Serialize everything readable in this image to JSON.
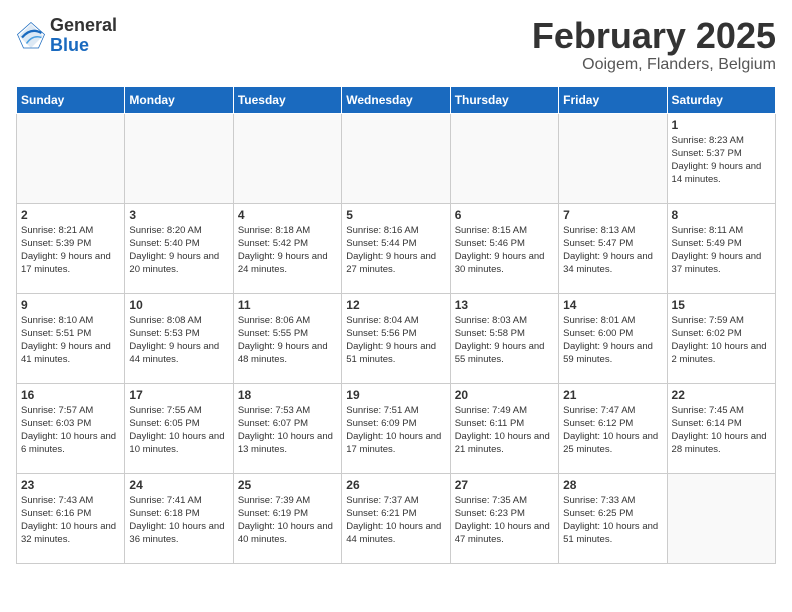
{
  "header": {
    "logo_general": "General",
    "logo_blue": "Blue",
    "month_title": "February 2025",
    "location": "Ooigem, Flanders, Belgium"
  },
  "days_of_week": [
    "Sunday",
    "Monday",
    "Tuesday",
    "Wednesday",
    "Thursday",
    "Friday",
    "Saturday"
  ],
  "weeks": [
    [
      {
        "day": "",
        "info": ""
      },
      {
        "day": "",
        "info": ""
      },
      {
        "day": "",
        "info": ""
      },
      {
        "day": "",
        "info": ""
      },
      {
        "day": "",
        "info": ""
      },
      {
        "day": "",
        "info": ""
      },
      {
        "day": "1",
        "info": "Sunrise: 8:23 AM\nSunset: 5:37 PM\nDaylight: 9 hours and 14 minutes."
      }
    ],
    [
      {
        "day": "2",
        "info": "Sunrise: 8:21 AM\nSunset: 5:39 PM\nDaylight: 9 hours and 17 minutes."
      },
      {
        "day": "3",
        "info": "Sunrise: 8:20 AM\nSunset: 5:40 PM\nDaylight: 9 hours and 20 minutes."
      },
      {
        "day": "4",
        "info": "Sunrise: 8:18 AM\nSunset: 5:42 PM\nDaylight: 9 hours and 24 minutes."
      },
      {
        "day": "5",
        "info": "Sunrise: 8:16 AM\nSunset: 5:44 PM\nDaylight: 9 hours and 27 minutes."
      },
      {
        "day": "6",
        "info": "Sunrise: 8:15 AM\nSunset: 5:46 PM\nDaylight: 9 hours and 30 minutes."
      },
      {
        "day": "7",
        "info": "Sunrise: 8:13 AM\nSunset: 5:47 PM\nDaylight: 9 hours and 34 minutes."
      },
      {
        "day": "8",
        "info": "Sunrise: 8:11 AM\nSunset: 5:49 PM\nDaylight: 9 hours and 37 minutes."
      }
    ],
    [
      {
        "day": "9",
        "info": "Sunrise: 8:10 AM\nSunset: 5:51 PM\nDaylight: 9 hours and 41 minutes."
      },
      {
        "day": "10",
        "info": "Sunrise: 8:08 AM\nSunset: 5:53 PM\nDaylight: 9 hours and 44 minutes."
      },
      {
        "day": "11",
        "info": "Sunrise: 8:06 AM\nSunset: 5:55 PM\nDaylight: 9 hours and 48 minutes."
      },
      {
        "day": "12",
        "info": "Sunrise: 8:04 AM\nSunset: 5:56 PM\nDaylight: 9 hours and 51 minutes."
      },
      {
        "day": "13",
        "info": "Sunrise: 8:03 AM\nSunset: 5:58 PM\nDaylight: 9 hours and 55 minutes."
      },
      {
        "day": "14",
        "info": "Sunrise: 8:01 AM\nSunset: 6:00 PM\nDaylight: 9 hours and 59 minutes."
      },
      {
        "day": "15",
        "info": "Sunrise: 7:59 AM\nSunset: 6:02 PM\nDaylight: 10 hours and 2 minutes."
      }
    ],
    [
      {
        "day": "16",
        "info": "Sunrise: 7:57 AM\nSunset: 6:03 PM\nDaylight: 10 hours and 6 minutes."
      },
      {
        "day": "17",
        "info": "Sunrise: 7:55 AM\nSunset: 6:05 PM\nDaylight: 10 hours and 10 minutes."
      },
      {
        "day": "18",
        "info": "Sunrise: 7:53 AM\nSunset: 6:07 PM\nDaylight: 10 hours and 13 minutes."
      },
      {
        "day": "19",
        "info": "Sunrise: 7:51 AM\nSunset: 6:09 PM\nDaylight: 10 hours and 17 minutes."
      },
      {
        "day": "20",
        "info": "Sunrise: 7:49 AM\nSunset: 6:11 PM\nDaylight: 10 hours and 21 minutes."
      },
      {
        "day": "21",
        "info": "Sunrise: 7:47 AM\nSunset: 6:12 PM\nDaylight: 10 hours and 25 minutes."
      },
      {
        "day": "22",
        "info": "Sunrise: 7:45 AM\nSunset: 6:14 PM\nDaylight: 10 hours and 28 minutes."
      }
    ],
    [
      {
        "day": "23",
        "info": "Sunrise: 7:43 AM\nSunset: 6:16 PM\nDaylight: 10 hours and 32 minutes."
      },
      {
        "day": "24",
        "info": "Sunrise: 7:41 AM\nSunset: 6:18 PM\nDaylight: 10 hours and 36 minutes."
      },
      {
        "day": "25",
        "info": "Sunrise: 7:39 AM\nSunset: 6:19 PM\nDaylight: 10 hours and 40 minutes."
      },
      {
        "day": "26",
        "info": "Sunrise: 7:37 AM\nSunset: 6:21 PM\nDaylight: 10 hours and 44 minutes."
      },
      {
        "day": "27",
        "info": "Sunrise: 7:35 AM\nSunset: 6:23 PM\nDaylight: 10 hours and 47 minutes."
      },
      {
        "day": "28",
        "info": "Sunrise: 7:33 AM\nSunset: 6:25 PM\nDaylight: 10 hours and 51 minutes."
      },
      {
        "day": "",
        "info": ""
      }
    ]
  ]
}
